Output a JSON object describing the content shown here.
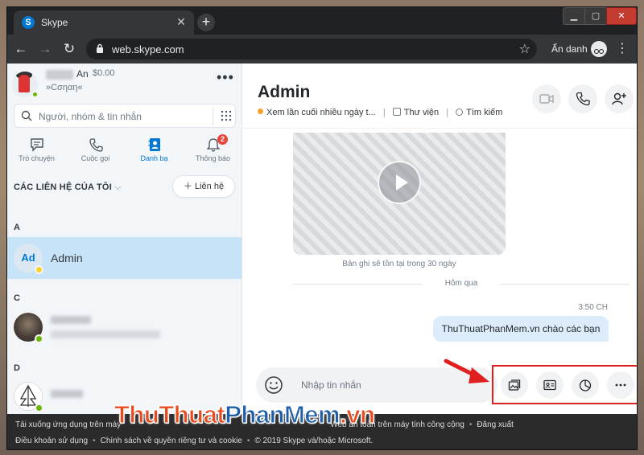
{
  "browser": {
    "tab_title": "Skype",
    "favicon_letter": "S",
    "url": "web.skype.com",
    "incognito_label": "Ẩn danh"
  },
  "profile": {
    "name_visible": "An",
    "credit": "$0.00",
    "mood": "»Cσηαη«"
  },
  "search": {
    "placeholder": "Người, nhóm & tin nhắn"
  },
  "nav_tabs": [
    {
      "label": "Trò chuyện"
    },
    {
      "label": "Cuộc gọi"
    },
    {
      "label": "Danh bạ",
      "active": true
    },
    {
      "label": "Thông báo",
      "badge": "2"
    }
  ],
  "contacts": {
    "header": "CÁC LIÊN HỆ CỦA TÔI",
    "add_label": "Liên hệ",
    "groups": [
      {
        "letter": "A"
      },
      {
        "letter": "C"
      },
      {
        "letter": "D"
      }
    ],
    "selected": {
      "initials": "Ad",
      "name": "Admin"
    }
  },
  "chat": {
    "title": "Admin",
    "last_seen": "Xem lần cuối nhiều ngày t...",
    "library": "Thư viện",
    "search": "Tìm kiếm",
    "video_caption": "Bản ghi sẽ tồn tại trong 30 ngày",
    "date_separator": "Hôm qua",
    "message_time": "3:50 CH",
    "message_text": "ThuThuatPhanMem.vn chào các bạn",
    "composer_placeholder": "Nhập tin nhắn"
  },
  "footer": {
    "row1_left": "Tải xuống ứng dụng trên máy",
    "row1_right": "Web an toàn trên máy tính công cộng",
    "row1_logout": "Đăng xuất",
    "row2": [
      "Điều khoản sử dụng",
      "Chính sách về quyền riêng tư và cookie",
      "© 2019 Skype và/hoặc Microsoft."
    ]
  },
  "watermark": {
    "part1": "ThuThuat",
    "part2": "PhanMem",
    "part3": ".vn"
  },
  "colors": {
    "skype_blue": "#0078d4",
    "selected_contact": "#c6e3f7",
    "highlight_box": "#e02020"
  }
}
